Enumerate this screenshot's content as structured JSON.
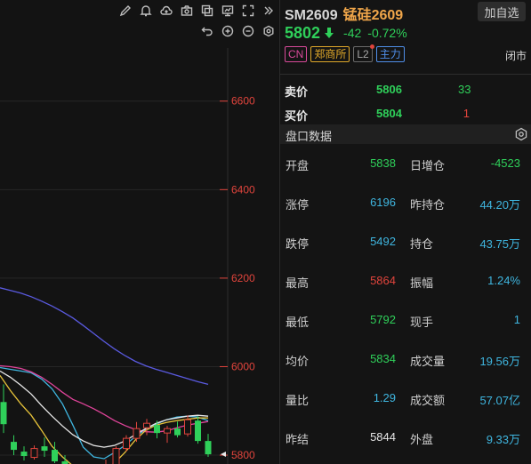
{
  "symbol": {
    "code": "SM2609",
    "name": "锰硅2609",
    "add_watch_label": "加自选"
  },
  "quote": {
    "last_price": "5802",
    "change": "-42",
    "change_pct": "-0.72%",
    "direction": "down",
    "market_status": "闭市"
  },
  "badges": {
    "cn": "CN",
    "exchange": "郑商所",
    "level2": "L2",
    "main": "主力"
  },
  "order_book": {
    "ask": {
      "label": "卖价",
      "price": "5806",
      "volume": "33"
    },
    "bid": {
      "label": "买价",
      "price": "5804",
      "volume": "1"
    }
  },
  "section": {
    "title": "盘口数据"
  },
  "stats": [
    {
      "l1": "开盘",
      "v1": "5838",
      "c1": "green",
      "l2": "日增仓",
      "v2": "-4523",
      "c2": "green"
    },
    {
      "l1": "涨停",
      "v1": "6196",
      "c1": "cyan",
      "l2": "昨持仓",
      "v2": "44.20万",
      "c2": "cyan"
    },
    {
      "l1": "跌停",
      "v1": "5492",
      "c1": "cyan",
      "l2": "持仓",
      "v2": "43.75万",
      "c2": "cyan"
    },
    {
      "l1": "最高",
      "v1": "5864",
      "c1": "red",
      "l2": "振幅",
      "v2": "1.24%",
      "c2": "cyan"
    },
    {
      "l1": "最低",
      "v1": "5792",
      "c1": "green",
      "l2": "现手",
      "v2": "1",
      "c2": "cyan"
    },
    {
      "l1": "均价",
      "v1": "5834",
      "c1": "green",
      "l2": "成交量",
      "v2": "19.56万",
      "c2": "cyan"
    },
    {
      "l1": "量比",
      "v1": "1.29",
      "c1": "cyan",
      "l2": "成交额",
      "v2": "57.07亿",
      "c2": "cyan"
    },
    {
      "l1": "昨结",
      "v1": "5844",
      "c1": "white",
      "l2": "外盘",
      "v2": "9.33万",
      "c2": "cyan"
    }
  ],
  "toolbar": {
    "row1_icons": [
      "pencil-icon",
      "bell-icon",
      "cloud-icon",
      "camera-icon",
      "copy-icon",
      "monitor-icon",
      "fullscreen-icon",
      "collapse-icon"
    ],
    "row2_icons": [
      "undo-icon",
      "zoom-in-icon",
      "zoom-out-icon",
      "settings-icon"
    ]
  },
  "chart_data": {
    "type": "candlestick",
    "y_axis_ticks": [
      "6600",
      "6400",
      "6200",
      "6000",
      "5800"
    ],
    "ylim": [
      5780,
      6720
    ],
    "last_price_marker": 5802,
    "moving_averages": [
      {
        "color": "#5a5ae0",
        "values": [
          6178,
          6172,
          6166,
          6158,
          6148,
          6137,
          6124,
          6110,
          6093,
          6075,
          6057,
          6040,
          6025,
          6012,
          6002,
          5994,
          5987,
          5980,
          5973,
          5966,
          5960
        ]
      },
      {
        "color": "#3fb6e0",
        "values": [
          5998,
          5994,
          5990,
          5986,
          5972,
          5950,
          5916,
          5868,
          5818,
          5796,
          5792,
          5806,
          5822,
          5842,
          5858,
          5870,
          5880,
          5886,
          5888,
          5886,
          5878
        ]
      },
      {
        "color": "#e0449a",
        "values": [
          6002,
          6000,
          5996,
          5988,
          5976,
          5960,
          5942,
          5926,
          5916,
          5905,
          5892,
          5878,
          5867,
          5858,
          5853,
          5852,
          5855,
          5862,
          5868,
          5872,
          5876
        ]
      },
      {
        "color": "#e8c43a",
        "values": [
          5980,
          5946,
          5916,
          5890,
          5856,
          5820,
          5796,
          5776,
          5766,
          5762,
          5766,
          5782,
          5806,
          5834,
          5856,
          5868,
          5874,
          5878,
          5881,
          5884,
          5884
        ]
      },
      {
        "color": "#e8e8e8",
        "values": [
          5990,
          5976,
          5958,
          5938,
          5912,
          5888,
          5866,
          5846,
          5832,
          5822,
          5818,
          5822,
          5832,
          5846,
          5860,
          5872,
          5880,
          5884,
          5888,
          5890,
          5888
        ]
      }
    ],
    "candles": [
      {
        "o": 5920,
        "h": 5960,
        "l": 5850,
        "c": 5870
      },
      {
        "o": 5830,
        "h": 5845,
        "l": 5800,
        "c": 5812
      },
      {
        "o": 5808,
        "h": 5820,
        "l": 5788,
        "c": 5798
      },
      {
        "o": 5795,
        "h": 5822,
        "l": 5790,
        "c": 5815
      },
      {
        "o": 5820,
        "h": 5840,
        "l": 5796,
        "c": 5810
      },
      {
        "o": 5812,
        "h": 5830,
        "l": 5782,
        "c": 5786
      },
      {
        "o": 5786,
        "h": 5800,
        "l": 5760,
        "c": 5770
      },
      {
        "o": 5770,
        "h": 5780,
        "l": 5742,
        "c": 5750
      },
      {
        "o": 5750,
        "h": 5770,
        "l": 5738,
        "c": 5762
      },
      {
        "o": 5762,
        "h": 5775,
        "l": 5735,
        "c": 5745
      },
      {
        "o": 5745,
        "h": 5790,
        "l": 5742,
        "c": 5778
      },
      {
        "o": 5778,
        "h": 5820,
        "l": 5770,
        "c": 5815
      },
      {
        "o": 5815,
        "h": 5845,
        "l": 5808,
        "c": 5838
      },
      {
        "o": 5838,
        "h": 5875,
        "l": 5830,
        "c": 5860
      },
      {
        "o": 5862,
        "h": 5882,
        "l": 5845,
        "c": 5872
      },
      {
        "o": 5868,
        "h": 5878,
        "l": 5838,
        "c": 5850
      },
      {
        "o": 5850,
        "h": 5866,
        "l": 5828,
        "c": 5860
      },
      {
        "o": 5860,
        "h": 5876,
        "l": 5840,
        "c": 5845
      },
      {
        "o": 5848,
        "h": 5890,
        "l": 5842,
        "c": 5880
      },
      {
        "o": 5878,
        "h": 5888,
        "l": 5826,
        "c": 5832
      },
      {
        "o": 5832,
        "h": 5848,
        "l": 5796,
        "c": 5802
      }
    ]
  }
}
